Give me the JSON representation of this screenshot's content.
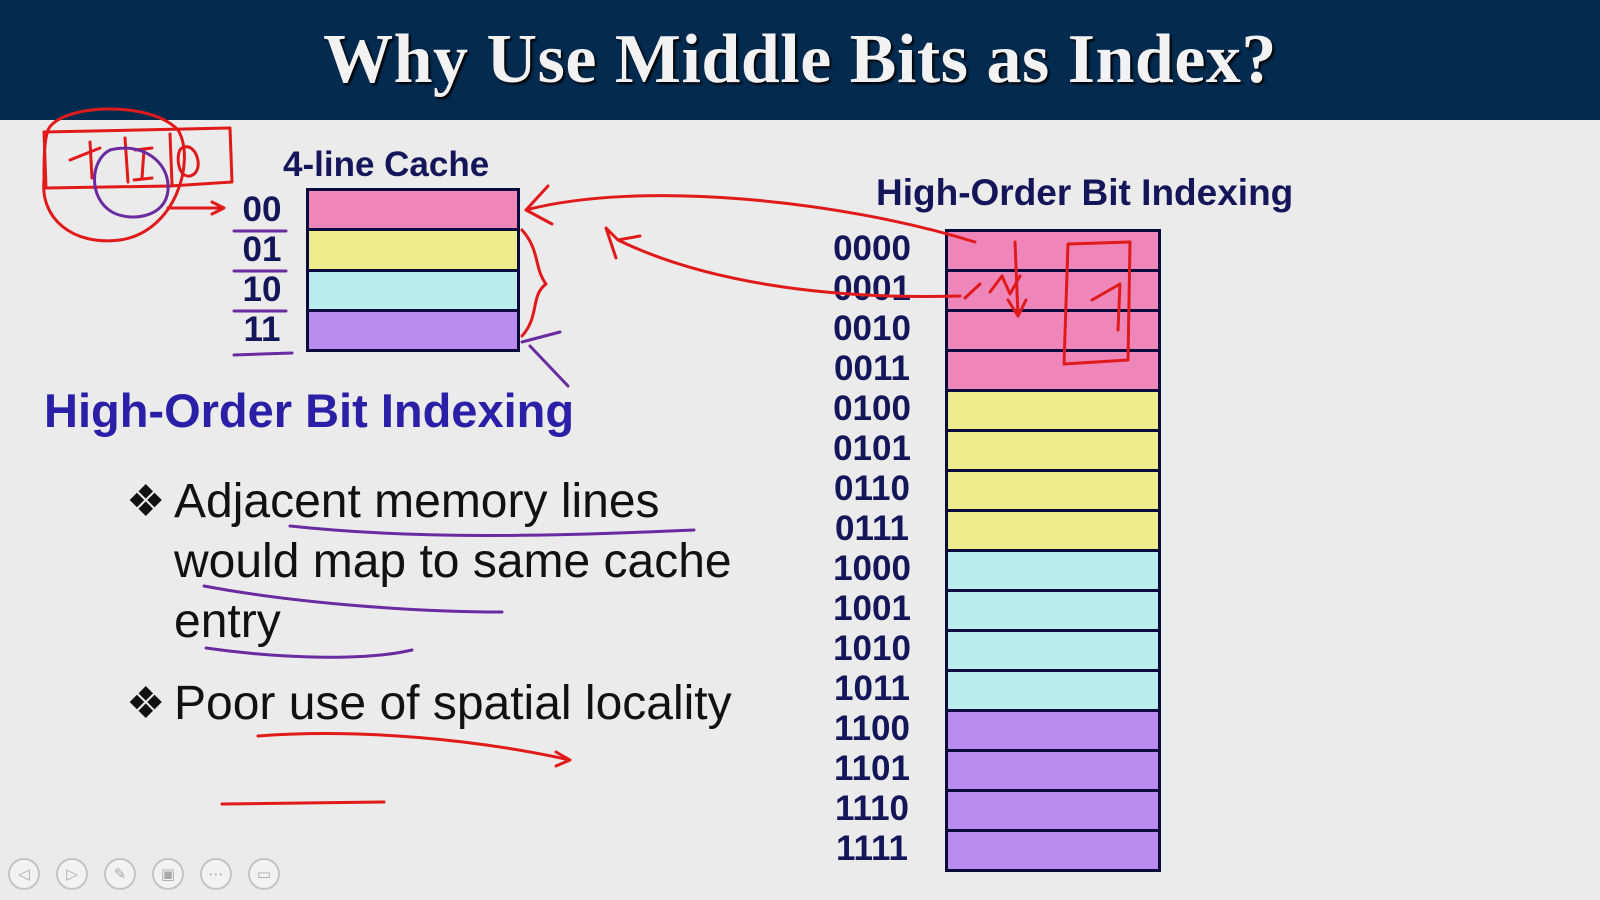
{
  "slide": {
    "title": "Why Use Middle Bits as Index?",
    "title_bar_color": "#032b50"
  },
  "cache": {
    "title": "4-line Cache",
    "lines": [
      {
        "label": "00",
        "color": "#ef86b9"
      },
      {
        "label": "01",
        "color": "#eeeb8c"
      },
      {
        "label": "10",
        "color": "#b8eced"
      },
      {
        "label": "11",
        "color": "#b98bec"
      }
    ]
  },
  "left_heading": "High-Order Bit Indexing",
  "bullets": [
    {
      "icon": "❖",
      "text": "Adjacent memory lines would map to same cache entry"
    },
    {
      "icon": "❖",
      "text": "Poor use of spatial locality"
    }
  ],
  "memory": {
    "title": "High-Order Bit Indexing",
    "lines": [
      {
        "label": "0000",
        "color": "#ef86b9"
      },
      {
        "label": "0001",
        "color": "#ef86b9"
      },
      {
        "label": "0010",
        "color": "#ef86b9"
      },
      {
        "label": "0011",
        "color": "#ef86b9"
      },
      {
        "label": "0100",
        "color": "#eeeb8c"
      },
      {
        "label": "0101",
        "color": "#eeeb8c"
      },
      {
        "label": "0110",
        "color": "#eeeb8c"
      },
      {
        "label": "0111",
        "color": "#eeeb8c"
      },
      {
        "label": "1000",
        "color": "#b8eced"
      },
      {
        "label": "1001",
        "color": "#b8eced"
      },
      {
        "label": "1010",
        "color": "#b8eced"
      },
      {
        "label": "1011",
        "color": "#b8eced"
      },
      {
        "label": "1100",
        "color": "#b98bec"
      },
      {
        "label": "1101",
        "color": "#b98bec"
      },
      {
        "label": "1110",
        "color": "#b98bec"
      },
      {
        "label": "1111",
        "color": "#b98bec"
      }
    ]
  },
  "controls": [
    {
      "name": "previous-slide-button",
      "icon": "◁"
    },
    {
      "name": "next-slide-button",
      "icon": "▷"
    },
    {
      "name": "pen-tool-button",
      "icon": "✎"
    },
    {
      "name": "slides-overview-button",
      "icon": "▣"
    },
    {
      "name": "more-options-button",
      "icon": "⋯"
    },
    {
      "name": "screen-options-button",
      "icon": "▭"
    }
  ],
  "annotation_colors": {
    "red": "#e01a1a",
    "purple": "#6a2aa0"
  }
}
